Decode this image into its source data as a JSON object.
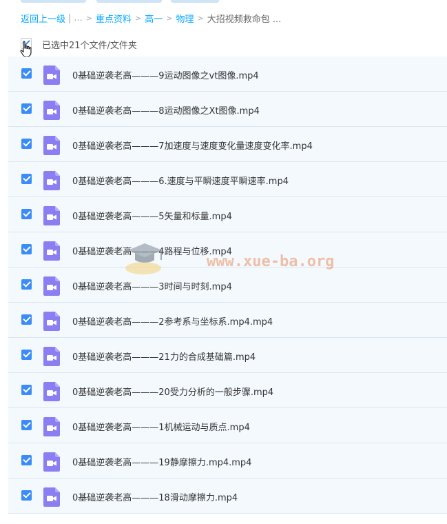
{
  "breadcrumb": {
    "back": "返回上一级",
    "ellipsis": "...",
    "items": [
      "重点资料",
      "高一",
      "物理"
    ],
    "current": "大招视频救命包 ..."
  },
  "selection": {
    "label": "已选中21个文件/文件夹"
  },
  "files": [
    {
      "name": "0基础逆袭老高———9运动图像之vt图像.mp4"
    },
    {
      "name": "0基础逆袭老高———8运动图像之Xt图像.mp4"
    },
    {
      "name": "0基础逆袭老高———7加速度与速度变化量速度变化率.mp4"
    },
    {
      "name": "0基础逆袭老高———6.速度与平瞬速度平瞬速率.mp4"
    },
    {
      "name": "0基础逆袭老高———5矢量和标量.mp4"
    },
    {
      "name": "0基础逆袭老高———4路程与位移.mp4"
    },
    {
      "name": "0基础逆袭老高———3时间与时刻.mp4"
    },
    {
      "name": "0基础逆袭老高———2参考系与坐标系.mp4.mp4"
    },
    {
      "name": "0基础逆袭老高———21力的合成基础篇.mp4"
    },
    {
      "name": "0基础逆袭老高———20受力分析的一般步骤.mp4"
    },
    {
      "name": "0基础逆袭老高———1机械运动与质点.mp4"
    },
    {
      "name": "0基础逆袭老高———19静摩擦力.mp4.mp4"
    },
    {
      "name": "0基础逆袭老高———18滑动摩擦力.mp4"
    }
  ],
  "watermark": {
    "text": "www.xue-ba.org"
  },
  "colors": {
    "link": "#09aaff",
    "checkbox": "#3b8cf6",
    "video_icon": "#8a7ef2",
    "row_bg": "#f3f9fd"
  },
  "icons": {
    "file": "video-file-icon",
    "pointer": "hand-cursor-icon"
  }
}
